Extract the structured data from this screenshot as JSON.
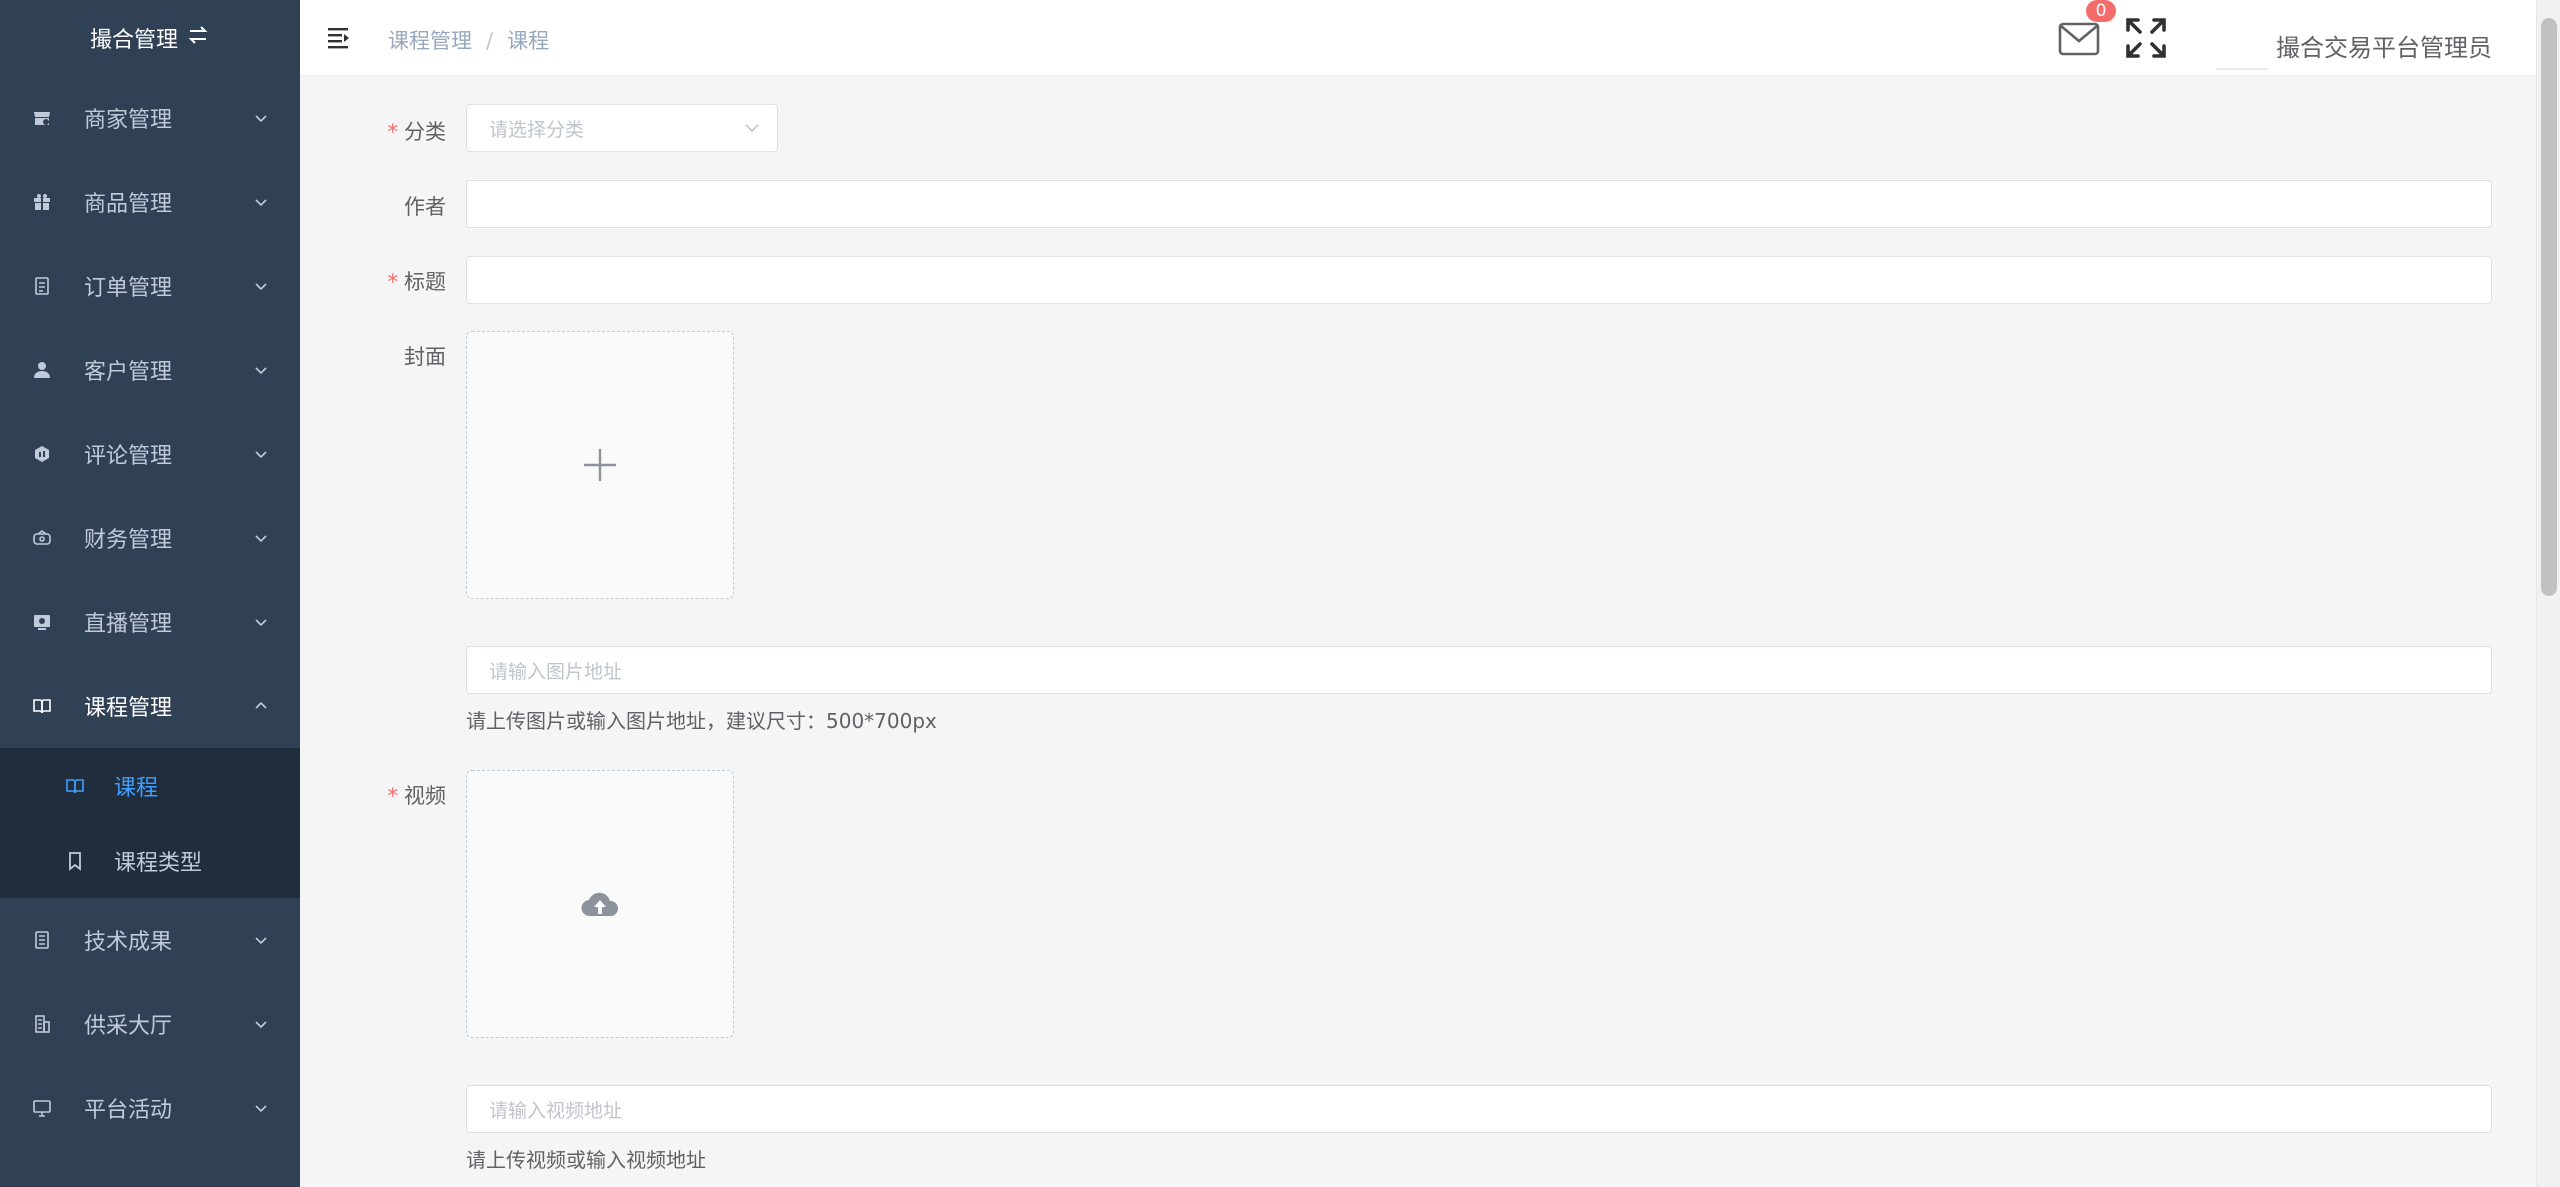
{
  "sidebar": {
    "title": "撮合管理",
    "swap_icon": "swap-icon",
    "items": [
      {
        "label": "商家管理",
        "icon": "shop-icon"
      },
      {
        "label": "商品管理",
        "icon": "gift-icon"
      },
      {
        "label": "订单管理",
        "icon": "document-icon"
      },
      {
        "label": "客户管理",
        "icon": "user-icon"
      },
      {
        "label": "评论管理",
        "icon": "comment-icon"
      },
      {
        "label": "财务管理",
        "icon": "wallet-icon"
      },
      {
        "label": "直播管理",
        "icon": "live-icon"
      },
      {
        "label": "课程管理",
        "icon": "book-icon"
      },
      {
        "label": "技术成果",
        "icon": "notebook-icon"
      },
      {
        "label": "供采大厅",
        "icon": "building-icon"
      },
      {
        "label": "平台活动",
        "icon": "monitor-icon"
      }
    ],
    "subitems": [
      {
        "label": "课程",
        "icon": "book-icon",
        "active": true
      },
      {
        "label": "课程类型",
        "icon": "bookmark-icon",
        "active": false
      }
    ]
  },
  "header": {
    "breadcrumb": [
      "课程管理",
      "课程"
    ],
    "breadcrumb_sep": "/",
    "message_count": "0",
    "username": "撮合交易平台管理员"
  },
  "form": {
    "required_mark": "*",
    "category_label": "分类",
    "category_placeholder": "请选择分类",
    "author_label": "作者",
    "author_value": "",
    "title_label": "标题",
    "title_value": "",
    "cover_label": "封面",
    "cover_url_placeholder": "请输入图片地址",
    "cover_tip": "请上传图片或输入图片地址，建议尺寸：500*700px",
    "video_label": "视频",
    "video_url_placeholder": "请输入视频地址",
    "video_tip": "请上传视频或输入视频地址"
  },
  "colors": {
    "sidebar_bg": "#304156",
    "submenu_bg": "#1f2d3d",
    "accent": "#409eff",
    "required": "#f56c6c",
    "badge": "#f56c6c"
  }
}
